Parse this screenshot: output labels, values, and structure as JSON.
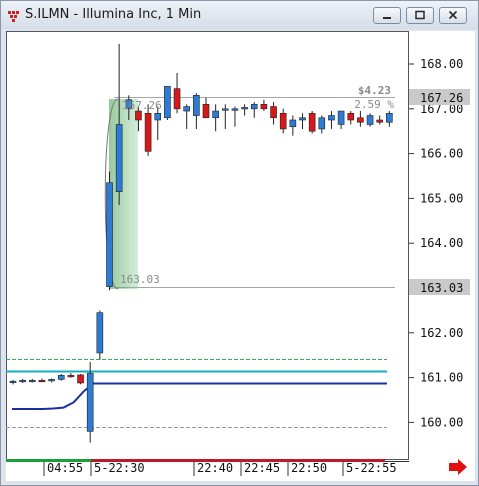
{
  "window": {
    "title": "S.ILMN - Illumina Inc, 1 Min"
  },
  "price_axis": {
    "ticks": [
      "168.00",
      "167.00",
      "166.00",
      "165.00",
      "164.00",
      "163.00",
      "162.00",
      "161.00",
      "160.00"
    ],
    "ylim": [
      159.55,
      168.65
    ],
    "last_price_label": "167.26",
    "low_marker_label": "163.03"
  },
  "time_axis": {
    "ticks": [
      "04:55",
      "5-22:30",
      "22:40",
      "22:45",
      "22:50",
      "5-22:55"
    ]
  },
  "measure_annotation": {
    "change_label": "$4.23",
    "percent_label": "2.59 %",
    "high_value_label": "167.26",
    "low_value_label": "163.03"
  },
  "colors": {
    "up": "#2e7bd6",
    "down": "#d81818",
    "accent_cyan": "#10b0c0",
    "line_navy": "#1c2fa0",
    "dash_green": "#30b050",
    "arrow_red": "#e01010"
  },
  "icons": {
    "app": "app-icon",
    "scroll": "red-arrow-right-icon"
  },
  "chart_data": {
    "type": "candlestick",
    "title": "S.ILMN - Illumina Inc, 1 Min",
    "candles": [
      {
        "o": 160.9,
        "h": 160.95,
        "l": 160.85,
        "c": 160.92
      },
      {
        "o": 160.92,
        "h": 160.97,
        "l": 160.88,
        "c": 160.94
      },
      {
        "o": 160.93,
        "h": 160.97,
        "l": 160.89,
        "c": 160.94
      },
      {
        "o": 160.94,
        "h": 160.98,
        "l": 160.9,
        "c": 160.93
      },
      {
        "o": 160.93,
        "h": 160.98,
        "l": 160.89,
        "c": 160.96
      },
      {
        "o": 160.96,
        "h": 161.08,
        "l": 160.93,
        "c": 161.05
      },
      {
        "o": 161.05,
        "h": 161.1,
        "l": 161.0,
        "c": 161.02
      },
      {
        "o": 161.06,
        "h": 161.08,
        "l": 160.85,
        "c": 160.88
      },
      {
        "o": 159.8,
        "h": 161.35,
        "l": 159.55,
        "c": 161.1
      },
      {
        "o": 161.55,
        "h": 162.5,
        "l": 161.4,
        "c": 162.45
      },
      {
        "o": 163.03,
        "h": 165.6,
        "l": 162.95,
        "c": 165.35
      },
      {
        "o": 165.15,
        "h": 168.45,
        "l": 164.85,
        "c": 166.65
      },
      {
        "o": 167.0,
        "h": 167.3,
        "l": 166.75,
        "c": 167.2
      },
      {
        "o": 166.95,
        "h": 167.05,
        "l": 166.5,
        "c": 166.75
      },
      {
        "o": 166.9,
        "h": 167.1,
        "l": 165.95,
        "c": 166.05
      },
      {
        "o": 166.75,
        "h": 167.05,
        "l": 166.3,
        "c": 166.9
      },
      {
        "o": 166.8,
        "h": 167.5,
        "l": 166.75,
        "c": 167.5
      },
      {
        "o": 167.45,
        "h": 167.8,
        "l": 166.9,
        "c": 167.0
      },
      {
        "o": 166.95,
        "h": 167.1,
        "l": 166.55,
        "c": 167.05
      },
      {
        "o": 166.85,
        "h": 167.35,
        "l": 166.55,
        "c": 167.3
      },
      {
        "o": 167.1,
        "h": 167.25,
        "l": 166.8,
        "c": 166.8
      },
      {
        "o": 166.8,
        "h": 167.1,
        "l": 166.5,
        "c": 166.95
      },
      {
        "o": 167.0,
        "h": 167.1,
        "l": 166.55,
        "c": 167.0
      },
      {
        "o": 167.0,
        "h": 167.05,
        "l": 166.6,
        "c": 167.0
      },
      {
        "o": 167.0,
        "h": 167.1,
        "l": 166.85,
        "c": 167.03
      },
      {
        "o": 167.0,
        "h": 167.15,
        "l": 166.8,
        "c": 167.1
      },
      {
        "o": 167.1,
        "h": 167.2,
        "l": 166.95,
        "c": 167.0
      },
      {
        "o": 167.05,
        "h": 167.15,
        "l": 166.65,
        "c": 166.8
      },
      {
        "o": 166.9,
        "h": 167.0,
        "l": 166.45,
        "c": 166.55
      },
      {
        "o": 166.6,
        "h": 166.85,
        "l": 166.4,
        "c": 166.75
      },
      {
        "o": 166.75,
        "h": 166.9,
        "l": 166.55,
        "c": 166.8
      },
      {
        "o": 166.9,
        "h": 166.95,
        "l": 166.45,
        "c": 166.5
      },
      {
        "o": 166.55,
        "h": 166.85,
        "l": 166.45,
        "c": 166.8
      },
      {
        "o": 166.75,
        "h": 166.95,
        "l": 166.55,
        "c": 166.85
      },
      {
        "o": 166.65,
        "h": 166.95,
        "l": 166.55,
        "c": 166.95
      },
      {
        "o": 166.9,
        "h": 166.95,
        "l": 166.65,
        "c": 166.75
      },
      {
        "o": 166.8,
        "h": 166.95,
        "l": 166.6,
        "c": 166.7
      },
      {
        "o": 166.65,
        "h": 166.9,
        "l": 166.6,
        "c": 166.85
      },
      {
        "o": 166.75,
        "h": 166.85,
        "l": 166.65,
        "c": 166.7
      },
      {
        "o": 166.7,
        "h": 166.95,
        "l": 166.6,
        "c": 166.9
      }
    ],
    "levels": [
      {
        "value": 161.42,
        "color": "#30b050",
        "style": "dashed"
      },
      {
        "value": 161.15,
        "color": "#10b0c0",
        "style": "solid"
      },
      {
        "value": 160.88,
        "color": "#1c2fa0",
        "style": "solid"
      },
      {
        "value": 159.9,
        "color": "#999999",
        "style": "dashed"
      },
      {
        "value": 167.26,
        "color": "#888888",
        "style": "thin"
      },
      {
        "value": 163.03,
        "color": "#888888",
        "style": "thin"
      }
    ],
    "vwap_curve": [
      160.3,
      160.3,
      160.3,
      160.3,
      160.31,
      160.33,
      160.45,
      160.7,
      160.88
    ],
    "ylim": [
      159.55,
      168.65
    ],
    "grid": false,
    "xlabel": "",
    "ylabel": ""
  }
}
